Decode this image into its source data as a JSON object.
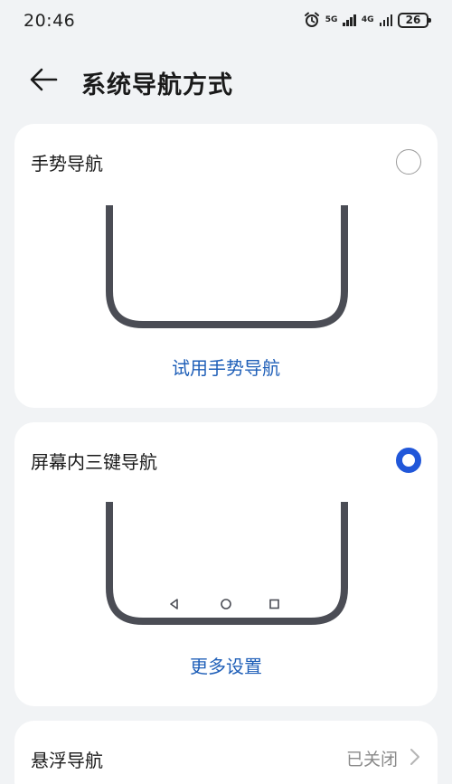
{
  "status_bar": {
    "time": "20:46",
    "network_1": "5G",
    "network_2": "4G",
    "battery": "26"
  },
  "header": {
    "title": "系统导航方式"
  },
  "gesture_nav": {
    "title": "手势导航",
    "selected": false,
    "link": "试用手势导航"
  },
  "three_key_nav": {
    "title": "屏幕内三键导航",
    "selected": true,
    "link": "更多设置"
  },
  "floating_nav": {
    "title": "悬浮导航",
    "value": "已关闭"
  },
  "colors": {
    "accent": "#2157d9",
    "link": "#1f5fb8",
    "background": "#f1f3f5",
    "illustration": "#4b4d55"
  }
}
